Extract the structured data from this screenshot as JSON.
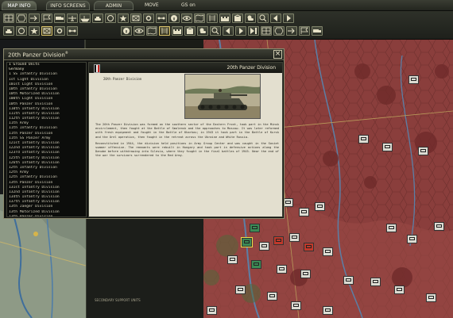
{
  "tabs": [
    {
      "label": "MAP INFO",
      "active": true
    },
    {
      "label": "INFO SCREENS",
      "active": false
    },
    {
      "label": "ADMIN",
      "active": false
    }
  ],
  "top_words": {
    "move": "MOVE",
    "gs": "GS on"
  },
  "window": {
    "title": "20th Panzer Division",
    "title_suffix": "®",
    "close_label": "×"
  },
  "unit_list": [
    {
      "text": "1 Ground Units",
      "head": true
    },
    {
      "text": "  Germany",
      "head": true
    },
    {
      "text": "1 SS Infantry Division"
    },
    {
      "text": "1st Light Division"
    },
    {
      "text": "101st Light Division"
    },
    {
      "text": "10th Infantry Division"
    },
    {
      "text": "10th Motorized Division"
    },
    {
      "text": "100th Light Division"
    },
    {
      "text": "10th Panzer Division"
    },
    {
      "text": "110th Infantry Division"
    },
    {
      "text": "111th Infantry Division"
    },
    {
      "text": "112th Infantry Division"
    },
    {
      "text": "11th Army"
    },
    {
      "text": "11th Infantry Division"
    },
    {
      "text": "11th Panzer Division"
    },
    {
      "text": "11th SS Panzer Army"
    },
    {
      "text": "121st Infantry Division"
    },
    {
      "text": "122nd Infantry Division"
    },
    {
      "text": "123rd Infantry Division"
    },
    {
      "text": "125th Infantry Division"
    },
    {
      "text": "126th Infantry Division"
    },
    {
      "text": "12th Infantry Division"
    },
    {
      "text": "12th Army"
    },
    {
      "text": "12th Infantry Division"
    },
    {
      "text": "13th Panzer Division"
    },
    {
      "text": "131st Infantry Division"
    },
    {
      "text": "132nd Infantry Division"
    },
    {
      "text": "134th Infantry Division"
    },
    {
      "text": "137th Infantry Division"
    },
    {
      "text": "13th Jaeger Division"
    },
    {
      "text": "13th Motorized Division"
    },
    {
      "text": "13th Panzer Division"
    },
    {
      "text": "1501st Fortress Volkssturm"
    },
    {
      "text": "15th Infantry Division"
    },
    {
      "text": "15th Infantry Division"
    }
  ],
  "detail": {
    "name": "20th Panzer Division",
    "caption": "20th Panzer Division",
    "paragraphs": [
      "The 20th Panzer Division was formed on the southern sector of the Eastern Front, took part in the Minsk encirclement, then fought at the Battle of Smolensk and the approaches to Moscow. It was later reformed with fresh equipment and fought in the Battle of Kharkov; in 1943 it took part in the Battle of Kursk and the Orel operation, then fought in the retreat across the Ukraine and White Russia.",
      "Reconstituted in 1944, the division held positions in Army Group Center and was caught in the Soviet summer offensive. The remnants were rebuilt in Hungary and took part in defensive actions along the Danube before withdrawing into Silesia, where they fought in the final battles of 1945. Near the end of the war the survivors surrendered to the Red Army."
    ]
  },
  "status_text": "SECONDARY SUPPORT UNITS",
  "colors": {
    "map": "#8a3e3c",
    "accent": "#d9c36a",
    "panel": "#111210"
  }
}
